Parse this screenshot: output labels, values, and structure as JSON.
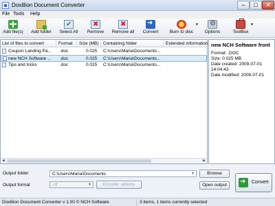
{
  "window": {
    "title": "Doxillion Document Converter"
  },
  "menu": [
    "File",
    "Tools",
    "Help"
  ],
  "toolbar": {
    "add_files": "Add file(s)",
    "add_folder": "Add folder",
    "select_all": "Select All",
    "remove": "Remove",
    "remove_all": "Remove all",
    "convert": "Convert",
    "burn": "Burn to disc",
    "options": "Options",
    "toolbox": "ToolBox"
  },
  "file_list": {
    "columns": [
      "List of files to convert",
      "Format",
      "Size (MB)",
      "Containing folder",
      "Extended information"
    ],
    "rows": [
      {
        "name": "Coupon Landing Pa...",
        "format": ".doc",
        "size": "0.025",
        "folder": "C:\\Users\\Maria\\Documents..."
      },
      {
        "name": "new NCH Software ...",
        "format": ".doc",
        "size": "0.025",
        "folder": "C:\\Users\\Maria\\Documents..."
      },
      {
        "name": "Tips and tricks",
        "format": ".doc",
        "size": "0.025",
        "folder": "C:\\Users\\Maria\\Documents..."
      }
    ]
  },
  "details": {
    "name": "new NCH Software front",
    "lines": [
      "Format: .DOC",
      "Size: 0.025 MB",
      "Date created: 2009-07-01",
      "14:04:43",
      "Date modified: 2009-07-01"
    ]
  },
  "output": {
    "folder_label": "Output folder",
    "folder_value": "C:\\Users\\Maria\\Documents",
    "browse": "Browse",
    "format_label": "Output format",
    "format_value": ".rtf",
    "encoder_options": "Encoder options",
    "open_output": "Open output",
    "convert": "Convert"
  },
  "status": {
    "left": "Doxillion Document Converter v 1.00 © NCH Software",
    "right": "3 items, 1 items currently selected"
  }
}
